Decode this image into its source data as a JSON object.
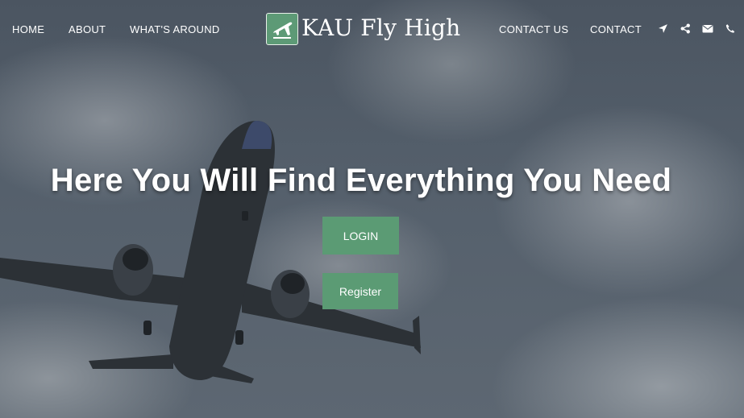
{
  "nav": {
    "left_links": [
      "HOME",
      "ABOUT",
      "WHAT'S AROUND"
    ],
    "right_links": [
      "CONTACT US",
      "CONTACT"
    ],
    "icons": [
      "location-arrow-icon",
      "share-icon",
      "envelope-icon",
      "phone-icon"
    ]
  },
  "brand": {
    "name": "KAU Fly High",
    "logo_icon": "airplane-landing-icon"
  },
  "hero": {
    "headline": "Here You Will Find Everything You Need",
    "login_label": "LOGIN",
    "register_label": "Register"
  },
  "colors": {
    "accent": "#5b9b74",
    "text": "#ffffff"
  }
}
